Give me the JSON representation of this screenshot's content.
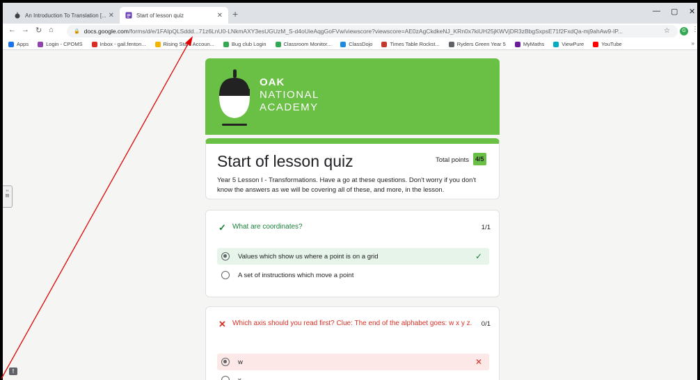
{
  "browser": {
    "tabs": [
      {
        "label": "An Introduction To Translation [...",
        "active": false
      },
      {
        "label": "Start of lesson quiz",
        "active": true
      }
    ],
    "url_host": "docs.google.com",
    "url_path": "/forms/d/e/1FAIpQLSddd...71z6LnU0-LNkmAXY3esUGUzM_S-d4oUieAqgGoFVw/viewscore?viewscore=AE0zAgCkdkeNJ_KRn0x7kiUH25jKWVjDR3zBbgSxpsE71f2FxdQa-mj9ahAw9-IP...",
    "profile_initial": "G"
  },
  "bookmarks": [
    {
      "label": "Apps",
      "icon": "apps-icon",
      "color": "#1a73e8"
    },
    {
      "label": "Login - CPOMS",
      "icon": "cpoms-icon",
      "color": "#8e44ad"
    },
    {
      "label": "Inbox - gail.fenton...",
      "icon": "gmail-icon",
      "color": "#d93025"
    },
    {
      "label": "Rising Stars Accoun...",
      "icon": "star-icon",
      "color": "#f4b400"
    },
    {
      "label": "Bug club Login",
      "icon": "bugclub-icon",
      "color": "#34a853"
    },
    {
      "label": "Classroom Monitor...",
      "icon": "classroom-icon",
      "color": "#34a853"
    },
    {
      "label": "ClassDojo",
      "icon": "dojo-icon",
      "color": "#1e88e5"
    },
    {
      "label": "Times Table Rockst...",
      "icon": "ttrs-icon",
      "color": "#c0392b"
    },
    {
      "label": "Ryders Green Year 5",
      "icon": "globe-icon",
      "color": "#5f6368"
    },
    {
      "label": "MyMaths",
      "icon": "mymaths-icon",
      "color": "#6a1b9a"
    },
    {
      "label": "ViewPure",
      "icon": "viewpure-icon",
      "color": "#00acc1"
    },
    {
      "label": "YouTube",
      "icon": "youtube-icon",
      "color": "#ff0000"
    }
  ],
  "banner": {
    "line1": "OAK",
    "line2": "NATIONAL",
    "line3": "ACADEMY",
    "color": "#6abf45"
  },
  "quiz": {
    "title": "Start of lesson quiz",
    "total_label": "Total points",
    "total_score": "4/5",
    "description": "Year 5 Lesson I - Transformations.  Have a go at these questions.  Don't worry if you don't know the answers as we will be covering all of these, and more, in the lesson."
  },
  "questions": [
    {
      "text": "What are coordinates?",
      "score": "1/1",
      "options": [
        {
          "label": "Values which show us where a point is on a grid"
        },
        {
          "label": "A set of instructions which move a point"
        }
      ]
    },
    {
      "text": "Which axis should you read first? Clue: The end of the alphabet goes: w x y z.",
      "score": "0/1",
      "options": [
        {
          "label": "w"
        },
        {
          "label": "x"
        }
      ]
    }
  ]
}
